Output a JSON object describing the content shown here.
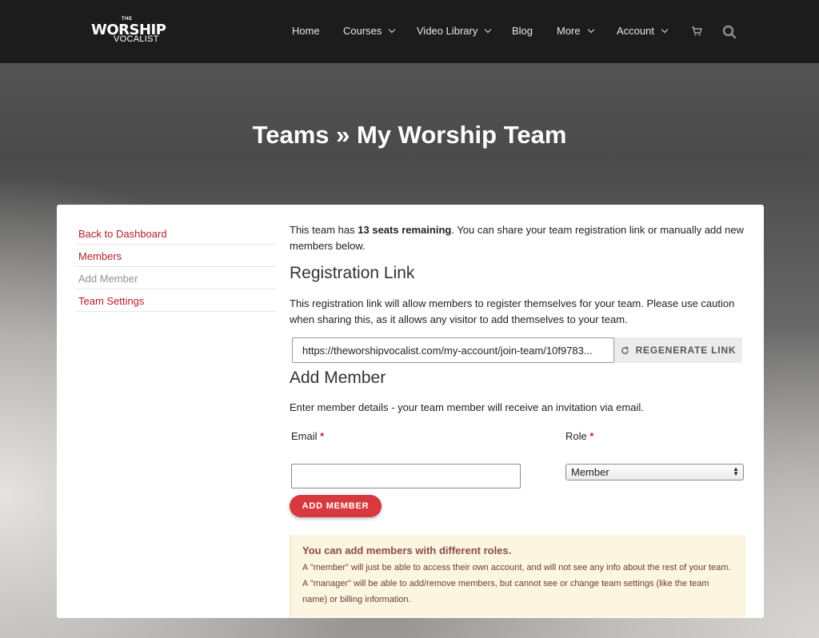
{
  "brand": {
    "logo_small": "THE",
    "logo_main": "WORSHIP",
    "logo_sub": "VOCALIST"
  },
  "nav": {
    "home": "Home",
    "courses": "Courses",
    "video_library": "Video Library",
    "blog": "Blog",
    "more": "More",
    "account": "Account",
    "cart_icon": "cart-icon",
    "search_icon": "search-icon"
  },
  "page": {
    "title": "Teams » My Worship Team"
  },
  "sidebar": {
    "items": [
      {
        "label": "Back to Dashboard",
        "state": "link"
      },
      {
        "label": "Members",
        "state": "link"
      },
      {
        "label": "Add Member",
        "state": "current"
      },
      {
        "label": "Team Settings",
        "state": "link"
      }
    ]
  },
  "main": {
    "intro_prefix": "This team has ",
    "intro_bold": "13 seats remaining",
    "intro_suffix": ". You can share your team registration link or manually add new members below.",
    "registration": {
      "heading": "Registration Link",
      "description": "This registration link will allow members to register themselves for your team. Please use caution when sharing this, as it allows any visitor to add themselves to your team.",
      "link_value": "https://theworshipvocalist.com/my-account/join-team/10f9783...",
      "regenerate_label": "REGENERATE LINK"
    },
    "add_member": {
      "heading": "Add Member",
      "description": "Enter member details - your team member will receive an invitation via email.",
      "email_label": "Email",
      "email_value": "",
      "role_label": "Role",
      "role_value": "Member",
      "required_mark": "*",
      "submit_label": "ADD MEMBER"
    },
    "notice": {
      "title": "You can add members with different roles.",
      "body": "A \"member\" will just be able to access their own account, and will not see any info about the rest of your team. A \"manager\" will be able to add/remove members, but cannot see or change team settings (like the team name) or billing information."
    }
  },
  "colors": {
    "header_bg": "#1c1c1c",
    "accent_red": "#b3202a",
    "button_red": "#d7393f",
    "notice_bg": "#fcf6e0"
  }
}
